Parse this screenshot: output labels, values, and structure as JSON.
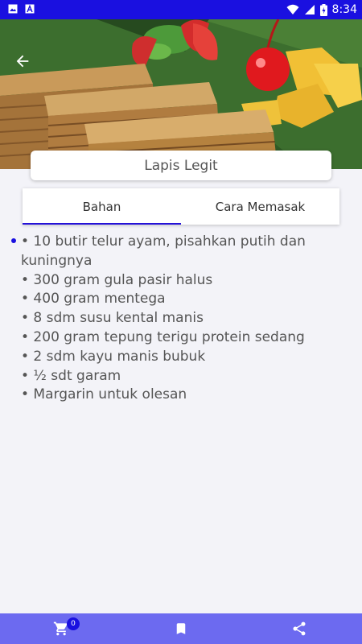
{
  "status_bar": {
    "time": "8:34",
    "left_icons": [
      "image-icon",
      "text-a-icon"
    ],
    "right_icons": [
      "wifi-icon",
      "signal-icon",
      "battery-icon"
    ]
  },
  "hero": {
    "back_icon": "arrow-back-icon"
  },
  "recipe": {
    "title": "Lapis Legit"
  },
  "tabs": [
    {
      "label": "Bahan",
      "active": true
    },
    {
      "label": "Cara Memasak",
      "active": false
    }
  ],
  "ingredients": [
    "• 10 butir telur ayam, pisahkan putih dan kuningnya",
    "• 300 gram gula pasir halus",
    "• 400 gram mentega",
    "• 8 sdm susu kental manis",
    "• 200 gram tepung terigu protein sedang",
    "• 2 sdm kayu manis bubuk",
    "• ½ sdt garam",
    "• Margarin untuk olesan"
  ],
  "bottom_bar": {
    "cart_icon": "cart-icon",
    "cart_count": "0",
    "bookmark_icon": "bookmark-icon",
    "share_icon": "share-icon"
  },
  "colors": {
    "status_bar": "#1a10e0",
    "accent": "#2411d8",
    "bottom_bar": "#6c6af0",
    "background": "#f3f3f8"
  }
}
